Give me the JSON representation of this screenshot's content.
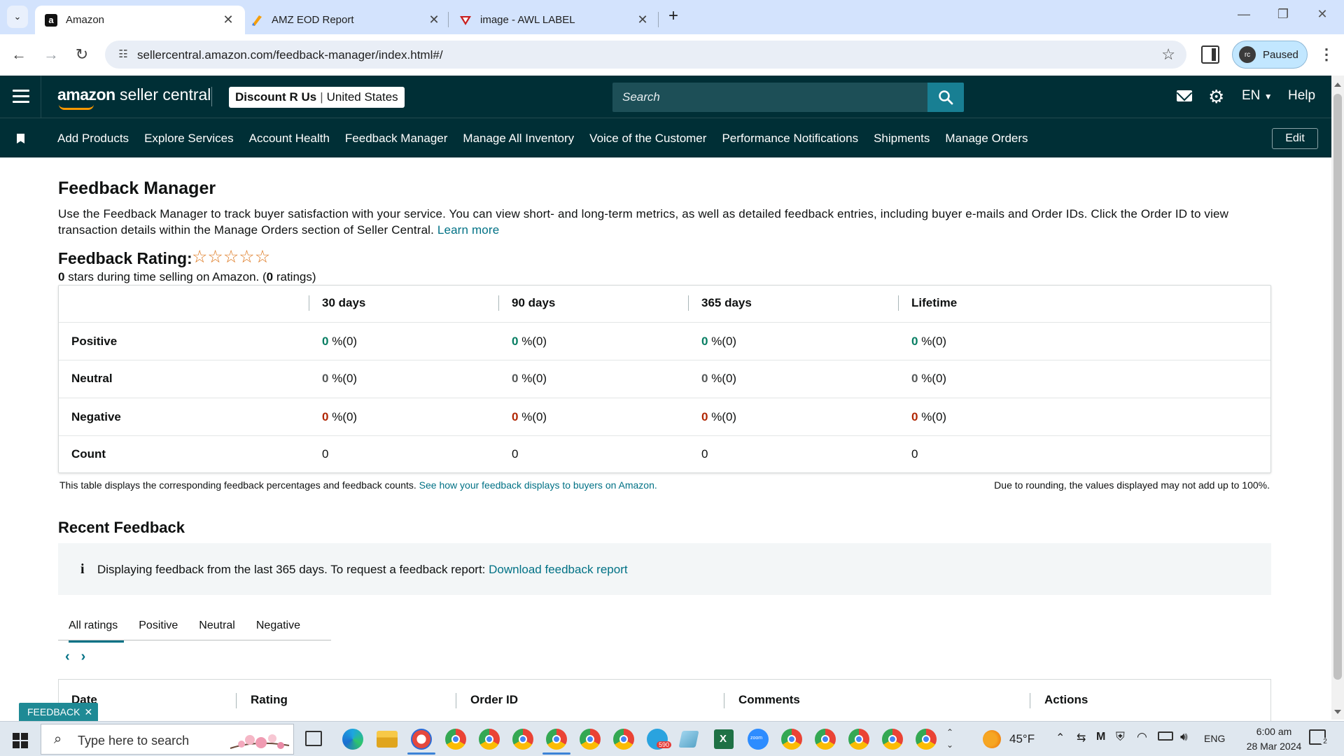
{
  "browser": {
    "tabs": [
      {
        "title": "Amazon",
        "active": true,
        "favicon": "amazon-icon"
      },
      {
        "title": "AMZ EOD Report",
        "active": false,
        "favicon": "pen-icon"
      },
      {
        "title": "image - AWL LABEL",
        "active": false,
        "favicon": "awl-icon"
      }
    ],
    "url": "sellercentral.amazon.com/feedback-manager/index.html#/",
    "profile_initials": "rc",
    "profile_status": "Paused"
  },
  "header": {
    "logo_text": "amazon",
    "logo_suffix": " seller central",
    "store_name": "Discount R Us",
    "marketplace": "United States",
    "search_placeholder": "Search",
    "language": "EN",
    "help": "Help"
  },
  "nav": {
    "items": [
      "Add Products",
      "Explore Services",
      "Account Health",
      "Feedback Manager",
      "Manage All Inventory",
      "Voice of the Customer",
      "Performance Notifications",
      "Shipments",
      "Manage Orders"
    ],
    "edit_label": "Edit"
  },
  "page": {
    "title": "Feedback Manager",
    "intro": "Use the Feedback Manager to track buyer satisfaction with your service. You can view short- and long-term metrics, as well as detailed feedback entries, including buyer e-mails and Order IDs. Click the Order ID to view transaction details within the Manage Orders section of Seller Central.",
    "learn_more": "Learn more",
    "rating_title": "Feedback Rating:",
    "rating_stars": 0,
    "rating_sub_count": "0",
    "rating_sub_mid": " stars during time selling on Amazon. (",
    "rating_sub_ratings": "0",
    "rating_sub_end": " ratings)"
  },
  "feedback_table": {
    "columns": [
      "30 days",
      "90 days",
      "365 days",
      "Lifetime"
    ],
    "rows": [
      {
        "label": "Positive",
        "kind": "pos",
        "values": [
          [
            "0",
            " %(0)"
          ],
          [
            "0",
            " %(0)"
          ],
          [
            "0",
            " %(0)"
          ],
          [
            "0",
            " %(0)"
          ]
        ]
      },
      {
        "label": "Neutral",
        "kind": "neu",
        "values": [
          [
            "0",
            " %(0)"
          ],
          [
            "0",
            " %(0)"
          ],
          [
            "0",
            " %(0)"
          ],
          [
            "0",
            " %(0)"
          ]
        ]
      },
      {
        "label": "Negative",
        "kind": "neg",
        "values": [
          [
            "0",
            " %(0)"
          ],
          [
            "0",
            " %(0)"
          ],
          [
            "0",
            " %(0)"
          ],
          [
            "0",
            " %(0)"
          ]
        ]
      },
      {
        "label": "Count",
        "kind": "count",
        "values": [
          [
            "0",
            ""
          ],
          [
            "0",
            ""
          ],
          [
            "0",
            ""
          ],
          [
            "0",
            ""
          ]
        ]
      }
    ],
    "note": "This table displays the corresponding feedback percentages and feedback counts.",
    "note_link": "See how your feedback displays to buyers on Amazon.",
    "note_right": "Due to rounding, the values displayed may not add up to 100%."
  },
  "recent": {
    "title": "Recent Feedback",
    "info_text": "Displaying feedback from the last 365 days. To request a feedback report:",
    "info_link": "Download feedback report",
    "tabs": [
      "All ratings",
      "Positive",
      "Neutral",
      "Negative"
    ],
    "active_tab": "All ratings",
    "columns": [
      "Date",
      "Rating",
      "Order ID",
      "Comments",
      "Actions"
    ]
  },
  "feedback_widget": {
    "label": "FEEDBACK",
    "close": "✕"
  },
  "taskbar": {
    "search_placeholder": "Type here to search",
    "weather": "45°F",
    "language": "ENG",
    "time": "6:00 am",
    "date": "28 Mar 2024",
    "telegram_badge": "590",
    "notification_count": "2"
  },
  "colors": {
    "header_bg": "#002f36",
    "link": "#007185",
    "positive": "#067d62",
    "negative": "#b12704",
    "star": "#de7921"
  }
}
